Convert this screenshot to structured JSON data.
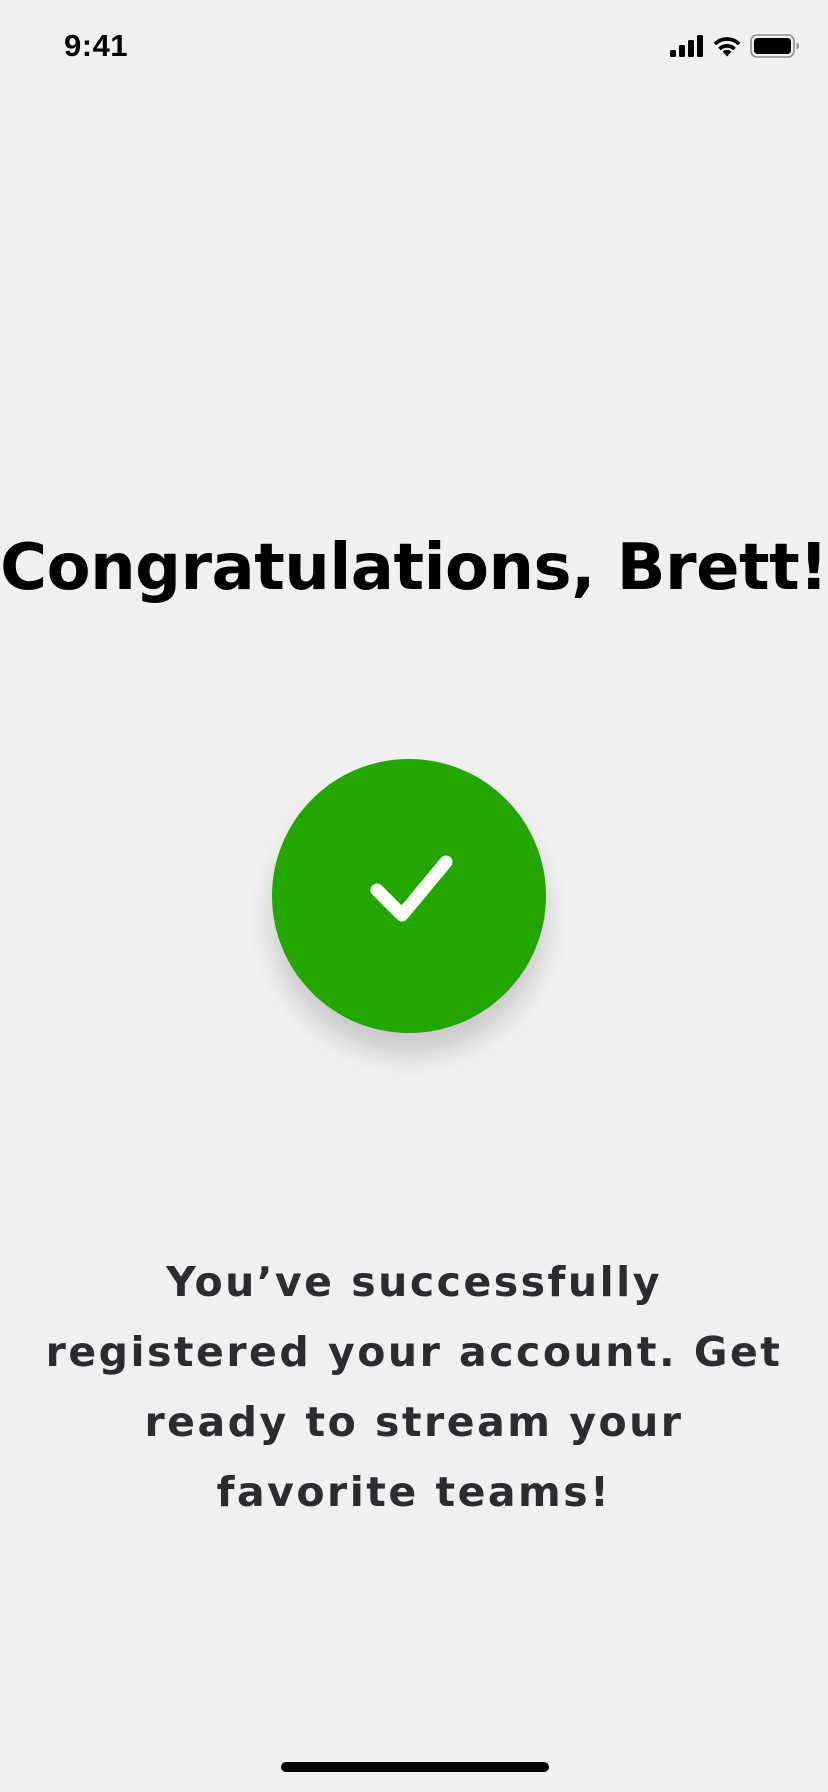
{
  "status_bar": {
    "time": "9:41",
    "icons": [
      "cellular-signal-icon",
      "wifi-icon",
      "battery-icon"
    ]
  },
  "title": "Congratulations, Brett!",
  "success_icon": "checkmark-icon",
  "message": "You’ve successfully registered your account. Get ready to stream your favorite teams!",
  "colors": {
    "background": "#f0f0f0",
    "success_green": "#23a600",
    "title_text": "#000000",
    "message_text": "#2b2b30"
  }
}
